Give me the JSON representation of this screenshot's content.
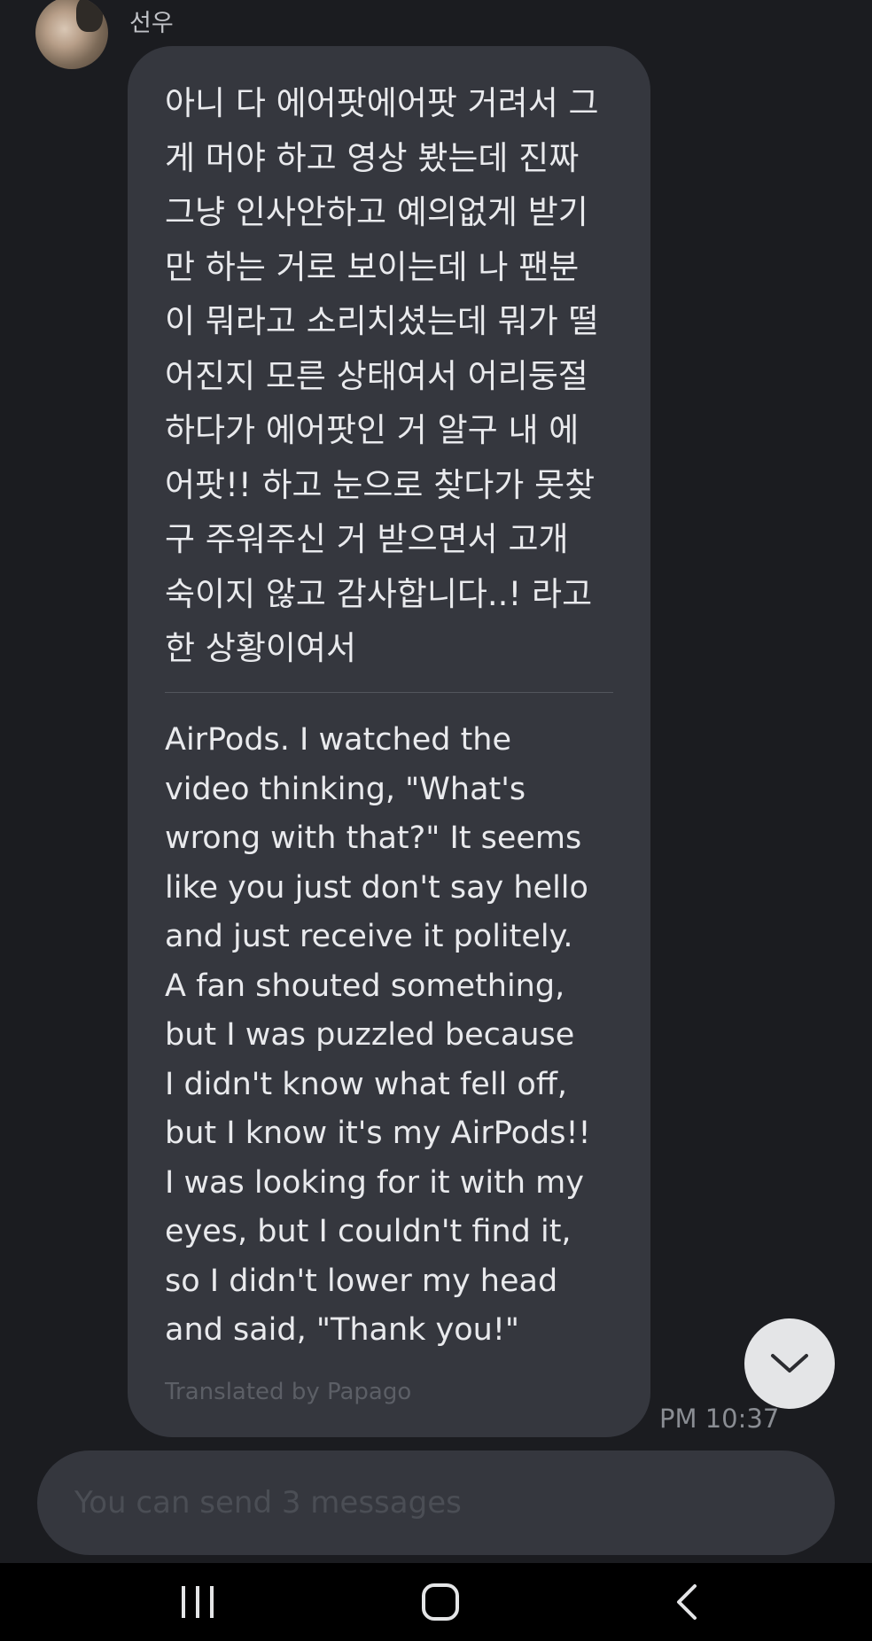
{
  "chat": {
    "sender_name": "선우",
    "message": {
      "original": "아니 다 에어팟에어팟 거려서 그\n게 머야 하고 영상 봤는데 진짜\n그냥 인사안하고 예의없게 받기\n만 하는 거로 보이는데 나 팬분\n이 뭐라고 소리치셨는데 뭐가 떨\n어진지 모른 상태여서 어리둥절\n하다가 에어팟인 거 알구 내 에\n어팟!! 하고 눈으로 찾다가 못찾\n구 주워주신 거 받으면서 고개\n숙이지 않고 감사합니다..! 라고\n한 상황이여서",
      "translated": "AirPods. I watched the\nvideo thinking, \"What's\nwrong with that?\" It seems\nlike you just don't say hello\nand just receive it politely.\nA fan shouted something,\nbut I was puzzled because\nI didn't know what fell off,\nbut I know it's my AirPods!!\nI was looking for it with my\neyes, but I couldn't find it,\nso I didn't lower my head\nand said, \"Thank you!\"",
      "translated_by": "Translated by Papago",
      "time": "PM 10:37"
    }
  },
  "composer": {
    "placeholder": "You can send 3 messages"
  },
  "icons": {
    "scroll_down": "chevron-down-icon",
    "nav_recents": "recents-icon",
    "nav_home": "home-icon",
    "nav_back": "back-icon"
  },
  "colors": {
    "background": "#1b1c20",
    "bubble": "#35373e",
    "text": "#e9eaed",
    "muted": "#5c5f66",
    "nav_bar": "#000000"
  }
}
